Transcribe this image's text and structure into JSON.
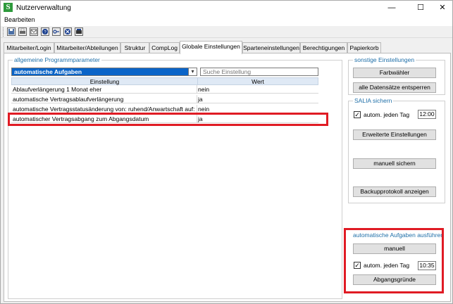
{
  "window": {
    "title": "Nutzerverwaltung",
    "app_icon_letter": "S",
    "min_symbol": "—",
    "max_symbol": "☐",
    "close_symbol": "✕"
  },
  "menubar": {
    "items": [
      "Bearbeiten"
    ]
  },
  "toolbar": {
    "icons": [
      "save-icon",
      "print-icon",
      "mail-icon",
      "help-icon",
      "key-icon",
      "cancel-icon",
      "export-icon"
    ]
  },
  "tabs": [
    {
      "label": "Mitarbeiter/Login"
    },
    {
      "label": "Mitarbeiter/Abteilungen"
    },
    {
      "label": "Struktur"
    },
    {
      "label": "CompLog"
    },
    {
      "label": "Globale Einstellungen",
      "active": true
    },
    {
      "label": "Sparteneinstellungen"
    },
    {
      "label": "Berechtigungen"
    },
    {
      "label": "Papierkorb"
    }
  ],
  "params": {
    "group_title": "allgemeine Programmparameter",
    "dropdown_value": "automatische Aufgaben",
    "search_placeholder": "Suche Einstellung",
    "columns": [
      "Einstellung",
      "Wert"
    ],
    "rows": [
      {
        "name": "Ablaufverlängerung 1 Monat eher",
        "value": "nein"
      },
      {
        "name": "automatische Vertragsablaufverlängerung",
        "value": "ja"
      },
      {
        "name": "automatische Vertragsstatusänderung von: ruhend/Anwartschaft auf: lebend",
        "value": "nein"
      },
      {
        "name": "automatischer Vertragsabgang zum Abgangsdatum",
        "value": "ja"
      }
    ]
  },
  "sonstige": {
    "group_title": "sonstige Einstellungen",
    "btn_color": "Farbwähler",
    "btn_unlock": "alle Datensätze entsperren"
  },
  "salia": {
    "group_title": "SALIA sichern",
    "auto_label": "autom. jeden Tag",
    "auto_checked": "✓",
    "auto_time": "12:00",
    "btn_extended": "Erweiterte Einstellungen",
    "btn_manual_save": "manuell sichern",
    "btn_backup_log": "Backupprotokoll anzeigen"
  },
  "tasks": {
    "group_title": "automatische Aufgaben ausführen",
    "btn_manual": "manuell",
    "auto_label": "autom. jeden Tag",
    "auto_checked": "✓",
    "auto_time": "10:35",
    "btn_reasons": "Abgangsgründe"
  },
  "colors": {
    "accent": "#1f6fa8",
    "highlight": "#e01b24",
    "selection": "#0a64c8"
  }
}
